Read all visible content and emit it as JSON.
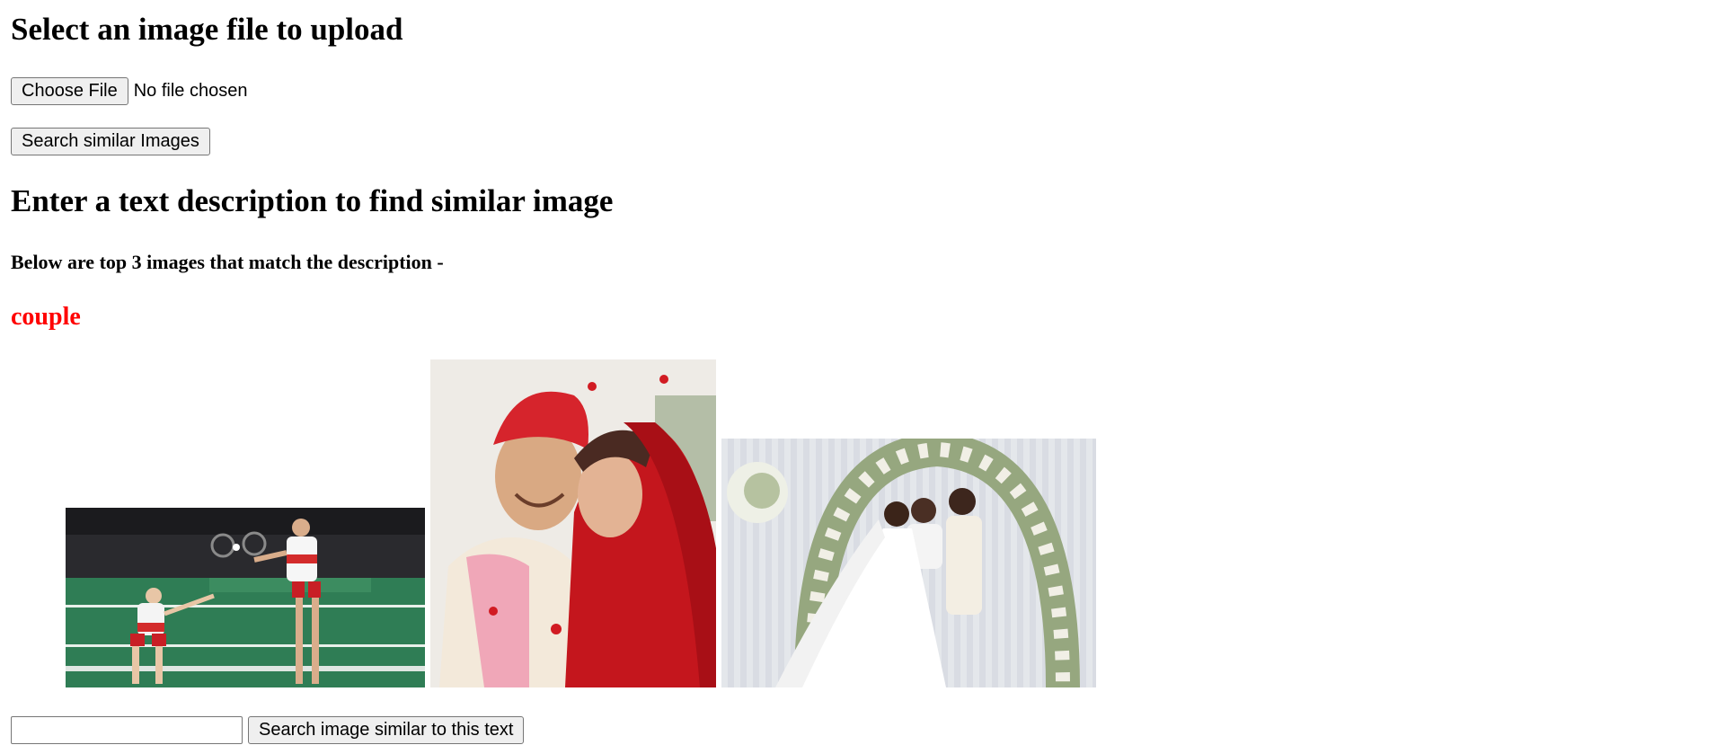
{
  "upload": {
    "heading": "Select an image file to upload",
    "choose_file_label": "Choose File",
    "file_status": "No file chosen",
    "search_button_label": "Search similar Images"
  },
  "text_search": {
    "heading": "Enter a text description to find similar image",
    "results_intro": "Below are top 3 images that match the description -",
    "query_term": "couple",
    "query_color": "#ff0000",
    "input_value": "",
    "button_label": "Search image similar to this text"
  },
  "results": [
    {
      "name": "result-image-badminton-mixed-doubles"
    },
    {
      "name": "result-image-indian-wedding-couple"
    },
    {
      "name": "result-image-wedding-ceremony-floral-arch"
    }
  ]
}
